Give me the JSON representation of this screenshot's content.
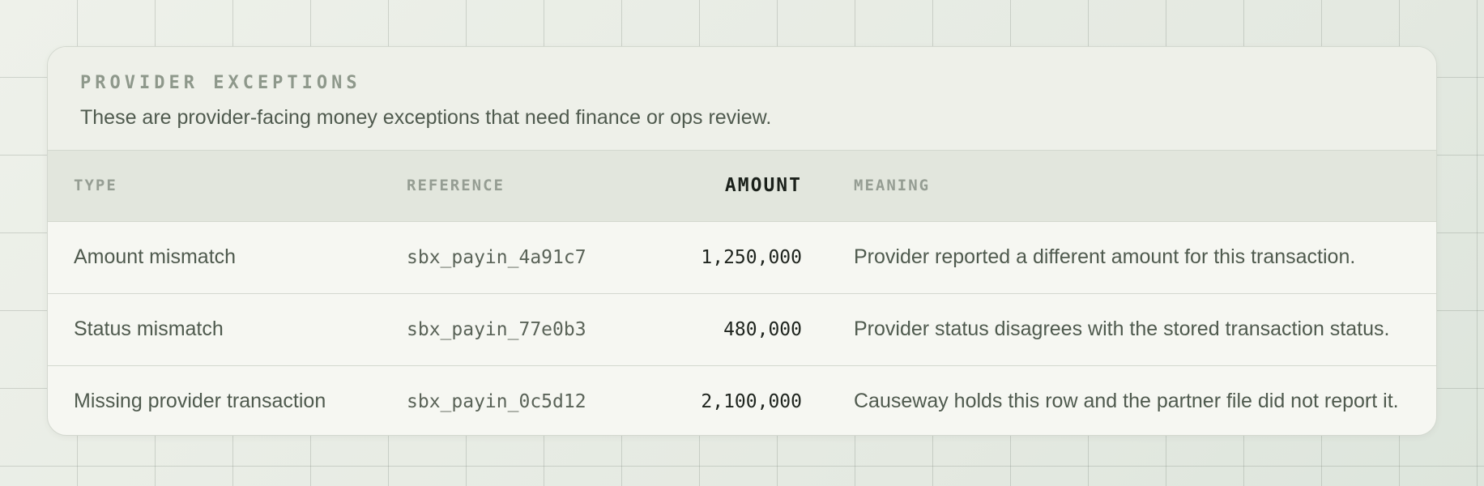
{
  "panel": {
    "eyebrow": "PROVIDER EXCEPTIONS",
    "subtitle": "These are provider-facing money exceptions that need finance or ops review."
  },
  "table": {
    "columns": {
      "type": "TYPE",
      "reference": "REFERENCE",
      "amount": "AMOUNT",
      "meaning": "MEANING"
    },
    "rows": [
      {
        "type": "Amount mismatch",
        "reference": "sbx_payin_4a91c7",
        "amount": "1,250,000",
        "meaning": "Provider reported a different amount for this transaction."
      },
      {
        "type": "Status mismatch",
        "reference": "sbx_payin_77e0b3",
        "amount": "480,000",
        "meaning": "Provider status disagrees with the stored transaction status."
      },
      {
        "type": "Missing provider transaction",
        "reference": "sbx_payin_0c5d12",
        "amount": "2,100,000",
        "meaning": "Causeway holds this row and the partner file did not report it."
      }
    ]
  },
  "colors": {
    "background": "#e9ede6",
    "card": "#f6f7f2",
    "header_band": "#e2e6dd",
    "text": "#4f5a4e",
    "muted": "#959d93"
  }
}
